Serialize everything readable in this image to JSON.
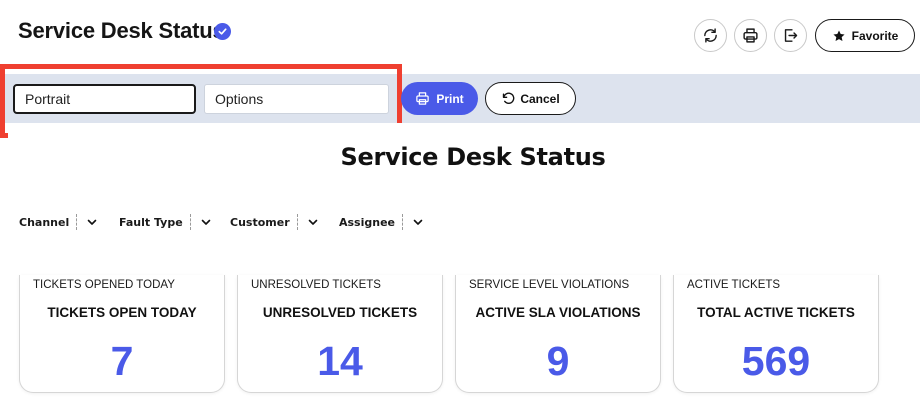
{
  "header": {
    "title": "Service Desk Status",
    "favorite_label": "Favorite"
  },
  "print_bar": {
    "orientation_value": "Portrait",
    "options_value": "Options",
    "print_label": "Print",
    "cancel_label": "Cancel"
  },
  "report": {
    "title": "Service Desk Status",
    "filters": [
      {
        "label": "Channel"
      },
      {
        "label": "Fault Type"
      },
      {
        "label": "Customer"
      },
      {
        "label": "Assignee"
      }
    ],
    "cards": [
      {
        "caption": "TICKETS OPENED TODAY",
        "heading": "TICKETS OPEN TODAY",
        "value": "7"
      },
      {
        "caption": "UNRESOLVED TICKETS",
        "heading": "UNRESOLVED TICKETS",
        "value": "14"
      },
      {
        "caption": "SERVICE LEVEL VIOLATIONS",
        "heading": "ACTIVE SLA VIOLATIONS",
        "value": "9"
      },
      {
        "caption": "ACTIVE TICKETS",
        "heading": "TOTAL ACTIVE TICKETS",
        "value": "569"
      }
    ]
  },
  "icons": {
    "verified": "check-circle-icon",
    "refresh": "refresh-icon",
    "print": "printer-icon",
    "export": "export-icon",
    "favorite": "star-icon",
    "cancel": "undo-icon",
    "filter": "chevron-down-icon"
  },
  "colors": {
    "accent": "#4a5ae8",
    "highlight": "#ef3f30",
    "print_bar_bg": "#dde3ee"
  }
}
